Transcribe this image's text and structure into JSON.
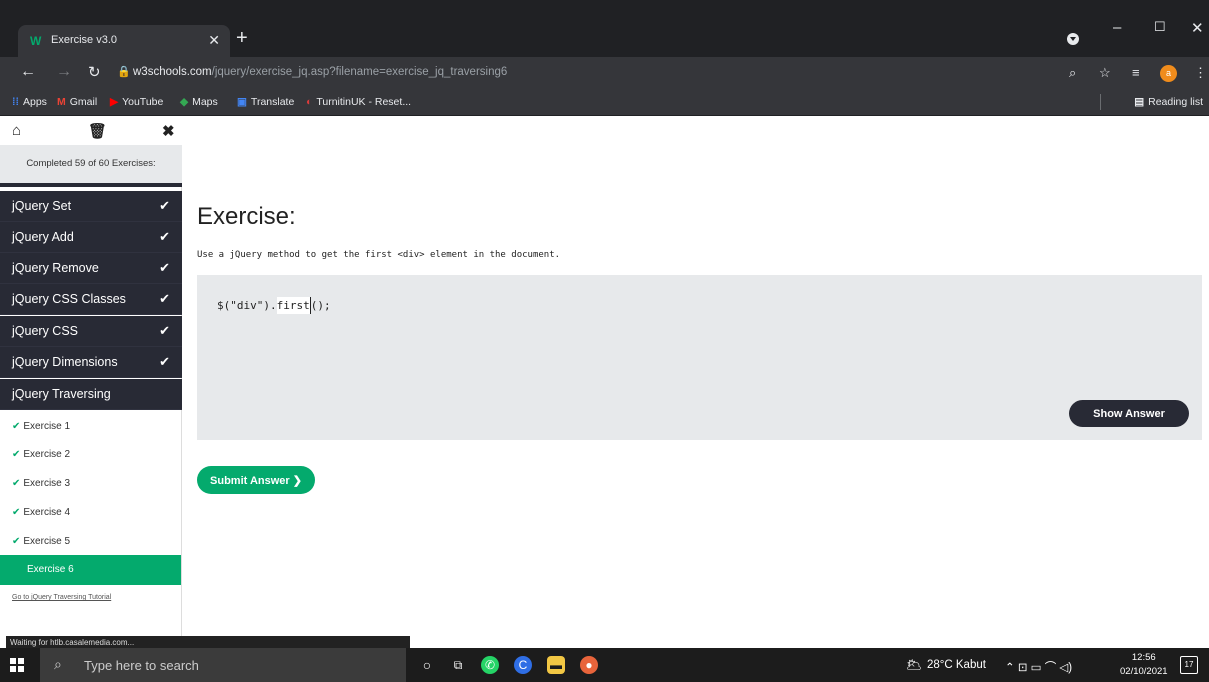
{
  "browser": {
    "tab_title": "Exercise v3.0",
    "favicon": "W",
    "new_tab": "+",
    "url_domain": "w3schools.com",
    "url_path": "/jquery/exercise_jq.asp?filename=exercise_jq_traversing6",
    "profile_initial": "a",
    "bookmarks": [
      "Apps",
      "Gmail",
      "YouTube",
      "Maps",
      "Translate",
      "TurnitinUK - Reset..."
    ],
    "reading_list": "Reading list"
  },
  "sidebar": {
    "progress": "Completed 59 of 60 Exercises:",
    "categories": [
      {
        "label": "jQuery Set",
        "done": true
      },
      {
        "label": "jQuery Add",
        "done": true
      },
      {
        "label": "jQuery Remove",
        "done": true
      },
      {
        "label": "jQuery CSS Classes",
        "done": true
      },
      {
        "label": "jQuery CSS",
        "done": true
      },
      {
        "label": "jQuery Dimensions",
        "done": true
      },
      {
        "label": "jQuery Traversing",
        "done": false
      }
    ],
    "exercises": [
      "Exercise 1",
      "Exercise 2",
      "Exercise 3",
      "Exercise 4",
      "Exercise 5",
      "Exercise 6"
    ],
    "active_exercise": "Exercise 6",
    "tutorial_link": "Go to jQuery Traversing Tutorial"
  },
  "exercise": {
    "title": "Exercise:",
    "description": "Use a jQuery method to get the first <div> element in the document.",
    "code_before": "$(\"div\").",
    "code_input": "first",
    "code_after": "();",
    "show_answer": "Show Answer",
    "submit": "Submit Answer ❯"
  },
  "status_bar": "Waiting for htlb.casalemedia.com...",
  "taskbar": {
    "search_placeholder": "Type here to search",
    "weather": "28°C  Kabut",
    "time": "12:56",
    "date": "02/10/2021",
    "notifications": "17"
  },
  "colors": {
    "accent": "#04aa6d",
    "dark": "#282a35"
  }
}
